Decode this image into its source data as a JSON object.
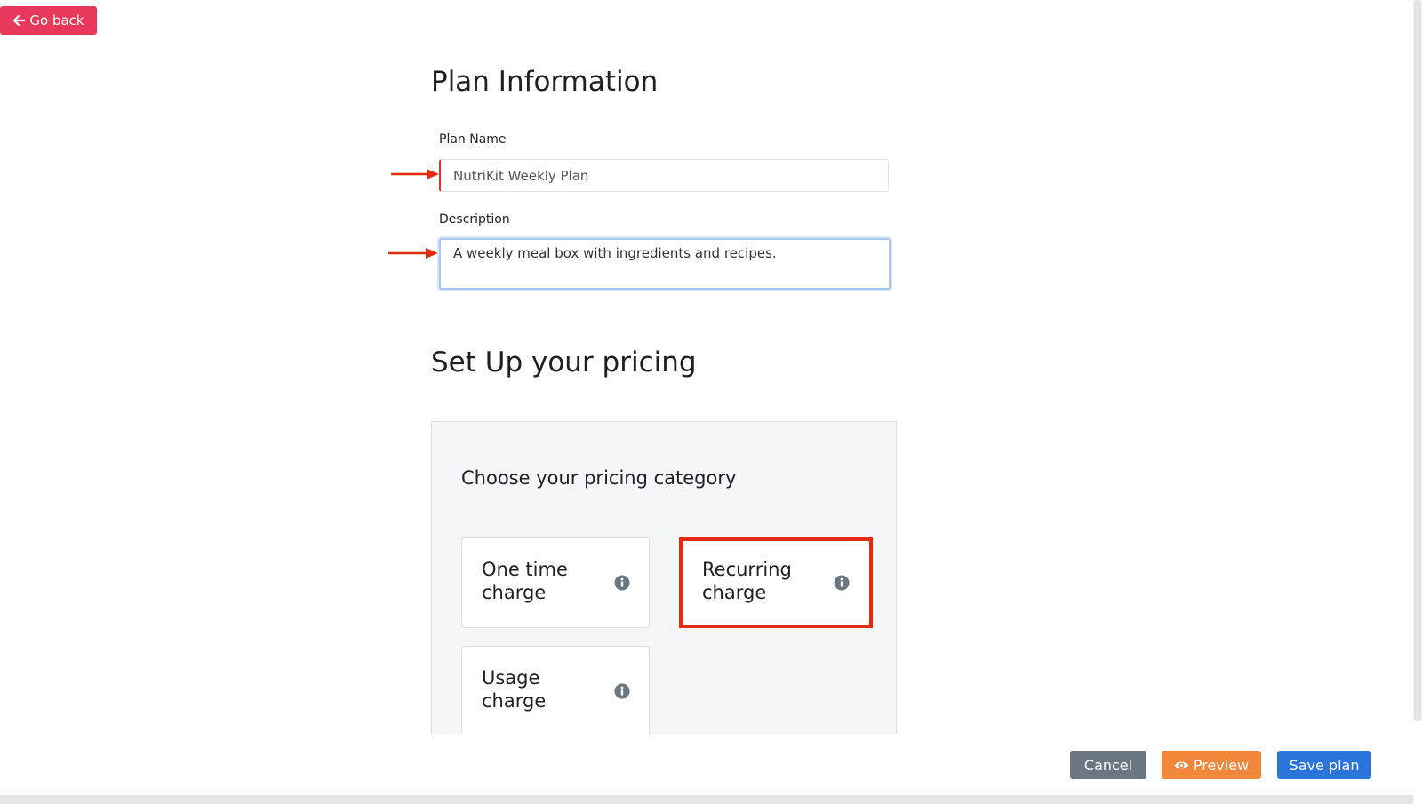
{
  "nav": {
    "go_back_label": "Go back"
  },
  "plan_info": {
    "title": "Plan Information",
    "plan_name_label": "Plan Name",
    "plan_name_value": "NutriKit Weekly Plan",
    "description_label": "Description",
    "description_value": "A weekly meal box with ingredients and recipes."
  },
  "pricing": {
    "title": "Set Up your pricing",
    "category_title": "Choose your pricing category",
    "options": [
      {
        "label": "One time charge",
        "icon": "info-icon",
        "selected": false
      },
      {
        "label": "Recurring charge",
        "icon": "info-icon",
        "selected": true
      },
      {
        "label": "Usage charge",
        "icon": "info-icon",
        "selected": false
      }
    ]
  },
  "footer": {
    "cancel_label": "Cancel",
    "preview_label": "Preview",
    "save_label": "Save plan"
  },
  "colors": {
    "go_back": "#e8395b",
    "cancel": "#6b7683",
    "preview": "#f0873a",
    "save": "#2b74d9",
    "highlight": "#e32b12"
  }
}
